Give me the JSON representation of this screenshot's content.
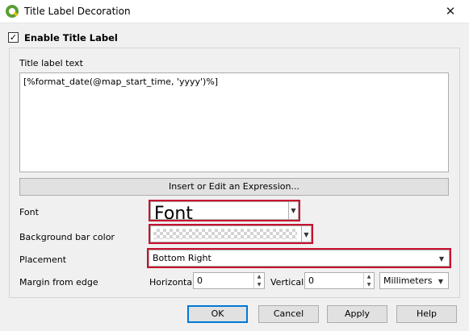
{
  "window": {
    "title": "Title Label Decoration",
    "close_glyph": "✕"
  },
  "enable_title_label": {
    "label": "Enable Title Label",
    "checked": true,
    "check_glyph": "✓"
  },
  "title_label_text": {
    "label": "Title label text",
    "value": "[%format_date(@map_start_time, 'yyyy')%]"
  },
  "insert_expression_button": "Insert or Edit an Expression...",
  "font": {
    "label": "Font",
    "preview": "Font"
  },
  "background_bar_color": {
    "label": "Background bar color"
  },
  "placement": {
    "label": "Placement",
    "selected": "Bottom Right"
  },
  "margin": {
    "label": "Margin from edge",
    "horizontal_label": "Horizontal",
    "horizontal_value": "0",
    "vertical_label": "Vertical",
    "vertical_value": "0",
    "unit": "Millimeters"
  },
  "buttons": {
    "ok": "OK",
    "cancel": "Cancel",
    "apply": "Apply",
    "help": "Help"
  },
  "colors": {
    "highlight": "#c8102e",
    "default_button_border": "#0078d7",
    "app_icon": "#5a9e34"
  }
}
